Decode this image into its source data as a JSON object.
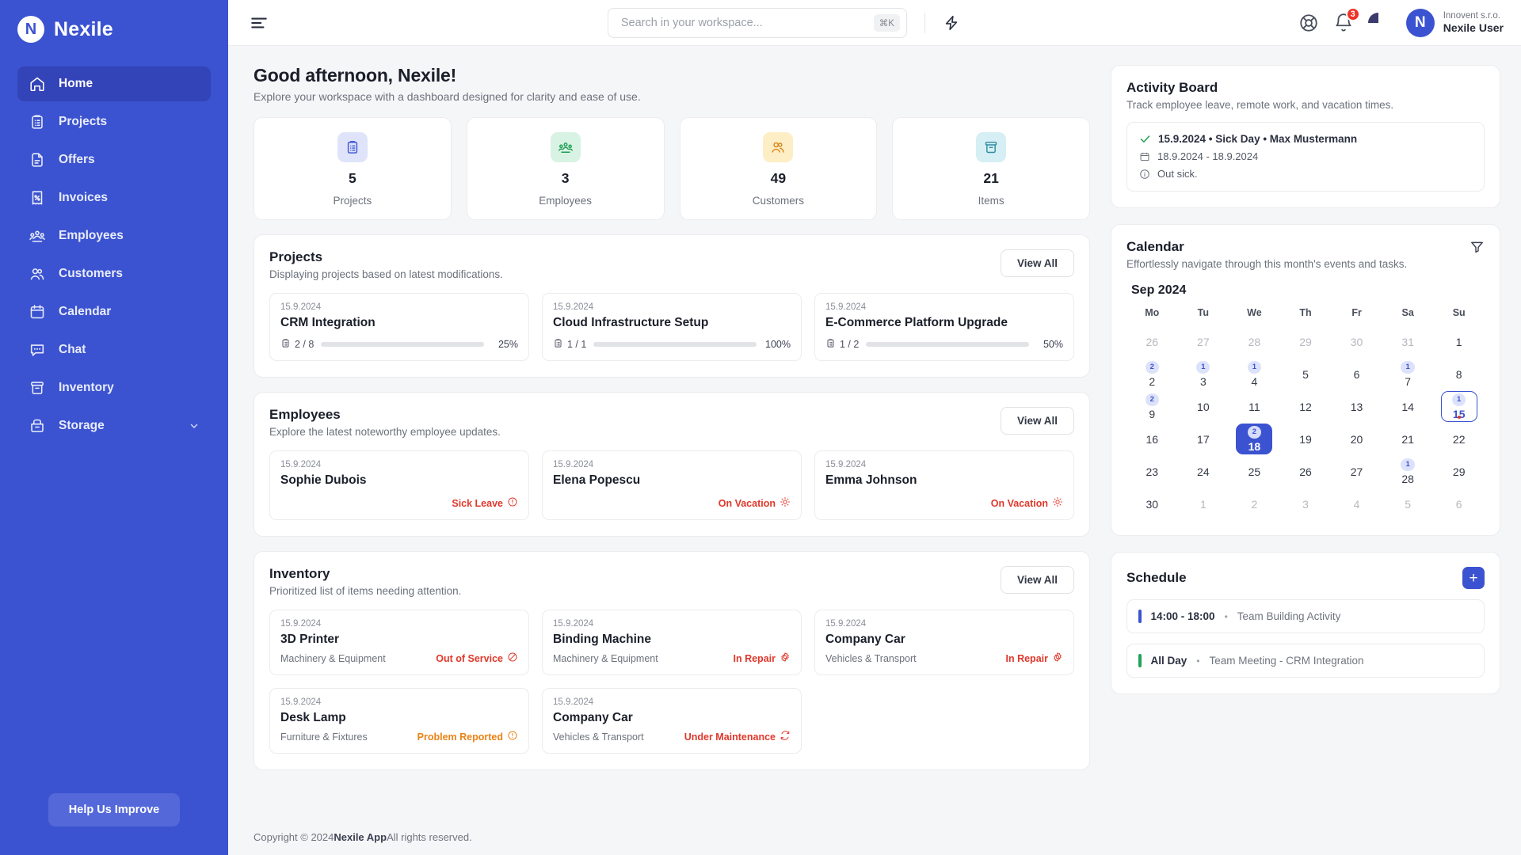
{
  "brand": {
    "name": "Nexile",
    "mark": "N"
  },
  "sidebar": {
    "items": [
      {
        "label": "Home",
        "icon": "home-icon"
      },
      {
        "label": "Projects",
        "icon": "clipboard-icon"
      },
      {
        "label": "Offers",
        "icon": "document-icon"
      },
      {
        "label": "Invoices",
        "icon": "invoice-icon"
      },
      {
        "label": "Employees",
        "icon": "employees-icon"
      },
      {
        "label": "Customers",
        "icon": "customers-icon"
      },
      {
        "label": "Calendar",
        "icon": "calendar-icon"
      },
      {
        "label": "Chat",
        "icon": "chat-icon"
      },
      {
        "label": "Inventory",
        "icon": "inventory-icon"
      },
      {
        "label": "Storage",
        "icon": "storage-icon",
        "expandable": true
      }
    ],
    "help_button": "Help Us Improve"
  },
  "topbar": {
    "search_placeholder": "Search in your workspace...",
    "search_value": "",
    "shortcut": "⌘K",
    "notifications_count": "3",
    "org": "Innovent s.r.o.",
    "user": "Nexile User",
    "avatar_letter": "N"
  },
  "greeting": {
    "title": "Good afternoon, Nexile!",
    "subtitle": "Explore your workspace with a dashboard designed for clarity and ease of use."
  },
  "stats": [
    {
      "value": "5",
      "label": "Projects",
      "icon": "clipboard-icon",
      "bg": "#dfe4fb",
      "fg": "#3b53d0"
    },
    {
      "value": "3",
      "label": "Employees",
      "icon": "employees-icon",
      "bg": "#d8f3e3",
      "fg": "#1f9d55"
    },
    {
      "value": "49",
      "label": "Customers",
      "icon": "customers-icon",
      "bg": "#fdeec6",
      "fg": "#d98415"
    },
    {
      "value": "21",
      "label": "Items",
      "icon": "inventory-icon",
      "bg": "#d5eff4",
      "fg": "#2f8c9e"
    }
  ],
  "projects": {
    "title": "Projects",
    "subtitle": "Displaying projects based on latest modifications.",
    "view_all": "View All",
    "items": [
      {
        "date": "15.9.2024",
        "title": "CRM Integration",
        "tasks": "2 / 8",
        "percent": "25%",
        "value": 25,
        "color": "#e0382b"
      },
      {
        "date": "15.9.2024",
        "title": "Cloud Infrastructure Setup",
        "tasks": "1 / 1",
        "percent": "100%",
        "value": 100,
        "color": "#22a357"
      },
      {
        "date": "15.9.2024",
        "title": "E-Commerce Platform Upgrade",
        "tasks": "1 / 2",
        "percent": "50%",
        "value": 50,
        "color": "#3b53d0"
      }
    ]
  },
  "employees": {
    "title": "Employees",
    "subtitle": "Explore the latest noteworthy employee updates.",
    "view_all": "View All",
    "items": [
      {
        "date": "15.9.2024",
        "title": "Sophie Dubois",
        "status": "Sick Leave",
        "status_icon": "alert-circle-icon",
        "color": "#e0382b"
      },
      {
        "date": "15.9.2024",
        "title": "Elena Popescu",
        "status": "On Vacation",
        "status_icon": "sun-icon",
        "color": "#e0382b"
      },
      {
        "date": "15.9.2024",
        "title": "Emma Johnson",
        "status": "On Vacation",
        "status_icon": "sun-icon",
        "color": "#e0382b"
      }
    ]
  },
  "inventory": {
    "title": "Inventory",
    "subtitle": "Prioritized list of items needing attention.",
    "view_all": "View All",
    "items": [
      {
        "date": "15.9.2024",
        "title": "3D Printer",
        "category": "Machinery & Equipment",
        "status": "Out of Service",
        "status_icon": "ban-icon",
        "color": "#e0382b"
      },
      {
        "date": "15.9.2024",
        "title": "Binding Machine",
        "category": "Machinery & Equipment",
        "status": "In Repair",
        "status_icon": "gear-icon",
        "color": "#e0382b"
      },
      {
        "date": "15.9.2024",
        "title": "Company Car",
        "category": "Vehicles & Transport",
        "status": "In Repair",
        "status_icon": "gear-icon",
        "color": "#e0382b"
      },
      {
        "date": "15.9.2024",
        "title": "Desk Lamp",
        "category": "Furniture & Fixtures",
        "status": "Problem Reported",
        "status_icon": "alert-circle-icon",
        "color": "#ea8215"
      },
      {
        "date": "15.9.2024",
        "title": "Company Car",
        "category": "Vehicles & Transport",
        "status": "Under Maintenance",
        "status_icon": "refresh-icon",
        "color": "#e0382b"
      }
    ]
  },
  "activity_board": {
    "title": "Activity Board",
    "subtitle": "Track employee leave, remote work, and vacation times.",
    "item": {
      "headline": "15.9.2024 • Sick Day  •  Max Mustermann",
      "range": "18.9.2024 - 18.9.2024",
      "note": "Out sick."
    }
  },
  "calendar": {
    "title": "Calendar",
    "subtitle": "Effortlessly navigate through this month's events and tasks.",
    "month": "Sep 2024",
    "dow": [
      "Mo",
      "Tu",
      "We",
      "Th",
      "Fr",
      "Sa",
      "Su"
    ],
    "weeks": [
      [
        {
          "day": "26",
          "muted": true
        },
        {
          "day": "27",
          "muted": true
        },
        {
          "day": "28",
          "muted": true
        },
        {
          "day": "29",
          "muted": true
        },
        {
          "day": "30",
          "muted": true
        },
        {
          "day": "31",
          "muted": true
        },
        {
          "day": "1"
        }
      ],
      [
        {
          "day": "2",
          "badge": "2"
        },
        {
          "day": "3",
          "badge": "1"
        },
        {
          "day": "4",
          "badge": "1"
        },
        {
          "day": "5"
        },
        {
          "day": "6"
        },
        {
          "day": "7",
          "badge": "1"
        },
        {
          "day": "8"
        }
      ],
      [
        {
          "day": "9",
          "badge": "2"
        },
        {
          "day": "10"
        },
        {
          "day": "11"
        },
        {
          "day": "12"
        },
        {
          "day": "13"
        },
        {
          "day": "14"
        },
        {
          "day": "15",
          "badge": "1",
          "today": true
        }
      ],
      [
        {
          "day": "16"
        },
        {
          "day": "17"
        },
        {
          "day": "18",
          "badge": "2",
          "selected": true
        },
        {
          "day": "19"
        },
        {
          "day": "20"
        },
        {
          "day": "21"
        },
        {
          "day": "22"
        }
      ],
      [
        {
          "day": "23"
        },
        {
          "day": "24"
        },
        {
          "day": "25"
        },
        {
          "day": "26"
        },
        {
          "day": "27"
        },
        {
          "day": "28",
          "badge": "1"
        },
        {
          "day": "29"
        }
      ],
      [
        {
          "day": "30"
        },
        {
          "day": "1",
          "muted": true
        },
        {
          "day": "2",
          "muted": true
        },
        {
          "day": "3",
          "muted": true
        },
        {
          "day": "4",
          "muted": true
        },
        {
          "day": "5",
          "muted": true
        },
        {
          "day": "6",
          "muted": true
        }
      ]
    ]
  },
  "schedule": {
    "title": "Schedule",
    "add_label": "+",
    "items": [
      {
        "time": "14:00 - 18:00",
        "label": "Team Building Activity",
        "color": "#3b53d0"
      },
      {
        "time": "All Day",
        "label": "Team Meeting - CRM Integration",
        "color": "#22a357"
      }
    ]
  },
  "footer": {
    "prefix": "Copyright © 2024 ",
    "brand": "Nexile App",
    "suffix": " All rights reserved."
  }
}
